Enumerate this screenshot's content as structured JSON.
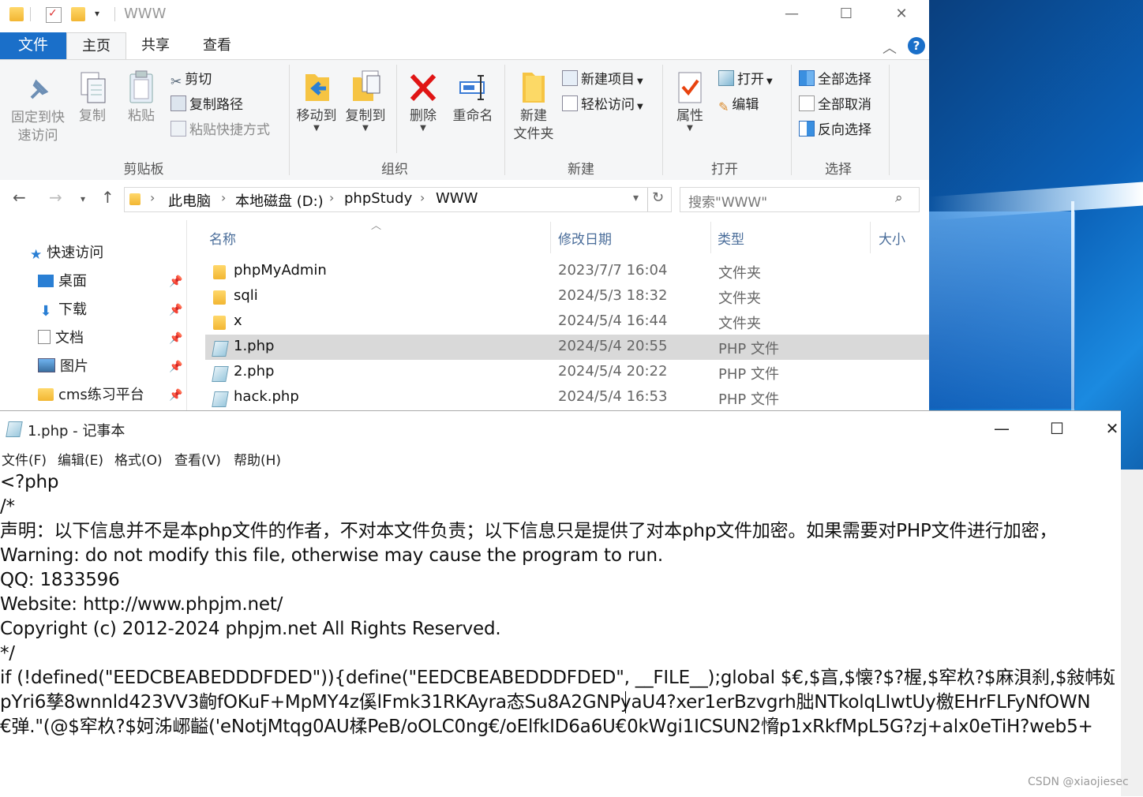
{
  "explorer": {
    "title": "WWW",
    "window_controls": [
      "—",
      "☐",
      "✕"
    ],
    "tabs": {
      "file": "文件",
      "home": "主页",
      "share": "共享",
      "view": "查看"
    },
    "ribbon": {
      "pin": "固定到快\n速访问",
      "copy": "复制",
      "paste": "粘贴",
      "cut": "剪切",
      "copy_path": "复制路径",
      "paste_shortcut": "粘贴快捷方式",
      "clipboard_group": "剪贴板",
      "move_to": "移动到",
      "copy_to": "复制到",
      "delete": "删除",
      "rename": "重命名",
      "organize_group": "组织",
      "new_folder": "新建\n文件夹",
      "new_item": "新建项目",
      "easy_access": "轻松访问",
      "new_group": "新建",
      "properties": "属性",
      "open": "打开",
      "edit": "编辑",
      "open_group": "打开",
      "select_all": "全部选择",
      "select_none": "全部取消",
      "invert_selection": "反向选择",
      "select_group": "选择"
    },
    "breadcrumb": [
      "此电脑",
      "本地磁盘 (D:)",
      "phpStudy",
      "WWW"
    ],
    "search_placeholder": "搜索\"WWW\"",
    "nav": {
      "quick_access": "快速访问",
      "items": [
        "桌面",
        "下载",
        "文档",
        "图片",
        "cms练习平台"
      ]
    },
    "columns": {
      "name": "名称",
      "modified": "修改日期",
      "type": "类型",
      "size": "大小"
    },
    "files": [
      {
        "name": "phpMyAdmin",
        "date": "2023/7/7 16:04",
        "type": "文件夹"
      },
      {
        "name": "sqli",
        "date": "2024/5/3 18:32",
        "type": "文件夹"
      },
      {
        "name": "x",
        "date": "2024/5/4 16:44",
        "type": "文件夹"
      },
      {
        "name": "1.php",
        "date": "2024/5/4 20:55",
        "type": "PHP 文件"
      },
      {
        "name": "2.php",
        "date": "2024/5/4 20:22",
        "type": "PHP 文件"
      },
      {
        "name": "hack.php",
        "date": "2024/5/4 16:53",
        "type": "PHP 文件"
      }
    ]
  },
  "notepad": {
    "title": "1.php - 记事本",
    "menu": [
      "文件(F)",
      "编辑(E)",
      "格式(O)",
      "查看(V)",
      "帮助(H)"
    ],
    "lines": [
      "<?php",
      "/*",
      "声明：以下信息并不是本php文件的作者，不对本文件负责；以下信息只是提供了对本php文件加密。如果需要对PHP文件进行加密，",
      "Warning: do not modify this file, otherwise may cause the program to run.",
      "QQ: 1833596",
      "Website: http://www.phpjm.net/",
      "Copyright (c) 2012-2024 phpjm.net All Rights Reserved.",
      "*/",
      "if (!defined(\"EEDCBEABEDDDFDED\")){define(\"EEDCBEABEDDDFDED\", __FILE__);global $€,$亯,$懐?$?楃,$窂杦?$麻浿刹,$敍帏姃?",
      "pYri6孳8wnnld423VV3齣fOKuF+MpMY4z傒lFmk31RKAyra态Su8A2GNPyaU4?xer1erBzvgrh朏NTkolqLIwtUy檄EHrFLFyNfOWN",
      "€弹.\"(@$窂杦?$妸泲峫齸('eNotjMtqg0AU楺PeB/oOLC0ng€/oElfkID6a6U€0kWgi1ICSUN2愶p1xRkfMpL5G?zj+alx0eTiH?web5+"
    ]
  },
  "watermark": "CSDN @xiaojiesec"
}
